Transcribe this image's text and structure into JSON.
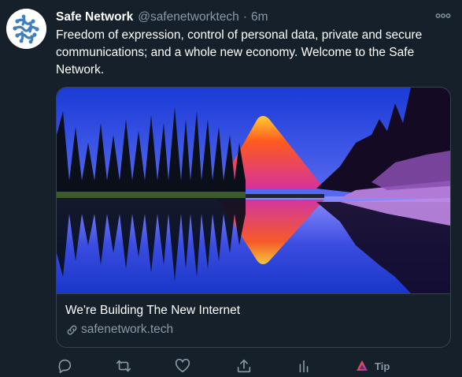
{
  "tweet": {
    "display_name": "Safe Network",
    "handle": "@safenetworktech",
    "separator": "·",
    "time": "6m",
    "text": "Freedom of expression, control of personal data, private and secure communications; and a whole new economy. Welcome to the Safe Network."
  },
  "card": {
    "title": "We're Building The New Internet",
    "domain": "safenetwork.tech"
  },
  "actions": {
    "tip_label": "Tip",
    "icons": [
      "reply-icon",
      "retweet-icon",
      "like-icon",
      "share-icon",
      "analytics-icon",
      "tip-icon"
    ]
  },
  "colors": {
    "background": "#15202b",
    "secondary_text": "#8b98a5",
    "border": "#38444d",
    "avatar_logo": "#3f7fbf"
  }
}
